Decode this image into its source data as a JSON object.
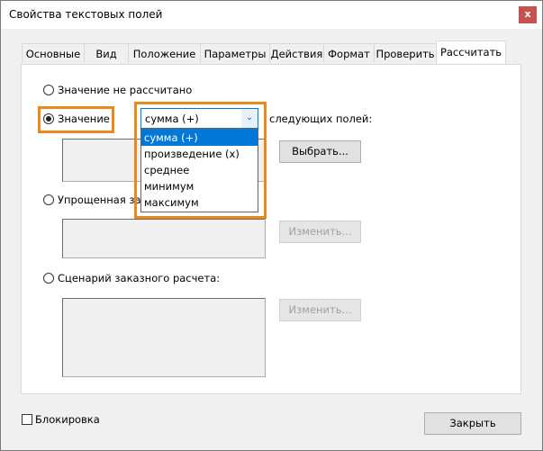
{
  "window": {
    "title": "Свойства текстовых полей",
    "close_label": "x"
  },
  "tabs": [
    "Основные",
    "Вид",
    "Положение",
    "Параметры",
    "Действия",
    "Формат",
    "Проверить",
    "Рассчитать"
  ],
  "calc": {
    "radio_none": "Значение не рассчитано",
    "radio_value": "Значение",
    "combo_value": "сумма (+)",
    "options": [
      "сумма (+)",
      "произведение (x)",
      "среднее",
      "минимум",
      "максимум"
    ],
    "following_fields": "следующих полей:",
    "pick_button": "Выбрать...",
    "radio_simplified": "Упрощенная за",
    "edit_button": "Изменить...",
    "radio_custom": "Сценарий заказного расчета:",
    "edit_button2": "Изменить..."
  },
  "footer": {
    "lock_label": "Блокировка",
    "close_button": "Закрыть"
  },
  "colors": {
    "highlight": "#e8891c",
    "selection": "#0078d7"
  }
}
